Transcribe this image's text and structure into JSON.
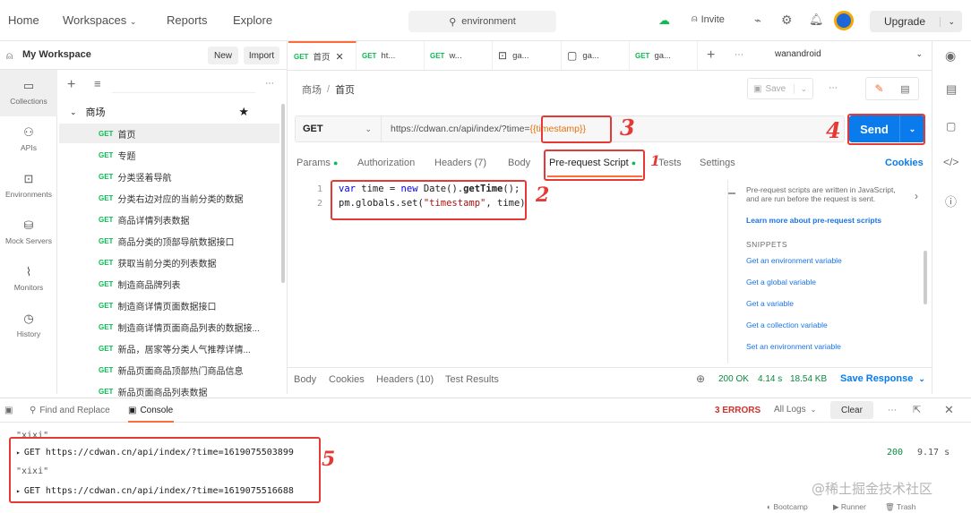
{
  "topbar": {
    "nav": [
      "Home",
      "Workspaces",
      "Reports",
      "Explore"
    ],
    "search_text": "environment",
    "invite": "Invite",
    "upgrade": "Upgrade"
  },
  "sidebar": {
    "workspace": "My Workspace",
    "new_label": "New",
    "import_label": "Import",
    "nav": [
      "Collections",
      "APIs",
      "Environments",
      "Mock Servers",
      "Monitors",
      "History"
    ],
    "collection_name": "商场",
    "method": "GET",
    "requests": [
      "首页",
      "专题",
      "分类竖着导航",
      "分类右边对应的当前分类的数据",
      "商品详情列表数据",
      "商品分类的顶部导航数据接口",
      "获取当前分类的列表数据",
      "制造商品牌列表",
      "制造商详情页面数据接口",
      "制造商详情页面商品列表的数据接...",
      "新品，居家等分类人气推荐详情...",
      "新品页面商品顶部热门商品信息",
      "新品页面商品列表数据"
    ]
  },
  "tabs": [
    {
      "method": "GET",
      "label": "首页"
    },
    {
      "method": "GET",
      "label": "ht..."
    },
    {
      "method": "GET",
      "label": "w..."
    },
    {
      "method": "",
      "label": "ga..."
    },
    {
      "method": "",
      "label": "ga..."
    },
    {
      "method": "GET",
      "label": "ga..."
    }
  ],
  "environment": "wanandroid",
  "breadcrumb": {
    "parent": "商场",
    "sep": "/",
    "current": "首页"
  },
  "save_label": "Save",
  "request": {
    "method": "GET",
    "url_prefix": "https://cdwan.cn/api/index/?time=",
    "url_var": "{{timestamp}}",
    "send": "Send",
    "tabs": [
      "Params",
      "Authorization",
      "Headers (7)",
      "Body",
      "Pre-request Script",
      "Tests",
      "Settings"
    ],
    "cookies": "Cookies"
  },
  "script": {
    "line_numbers": [
      "1",
      "2"
    ],
    "line1": {
      "kw1": "var",
      "mid": " time = ",
      "kw2": "new",
      "rest": " Date().",
      "fn": "getTime",
      "end": "();"
    },
    "line2": {
      "start": "pm.globals.set(",
      "str": "\"timestamp\"",
      "end": ", time)"
    }
  },
  "snippets": {
    "info": "Pre-request scripts are written in JavaScript, and are run before the request is sent.",
    "learn": "Learn more about pre-request scripts",
    "title": "SNIPPETS",
    "items": [
      "Get an environment variable",
      "Get a global variable",
      "Get a variable",
      "Get a collection variable",
      "Set an environment variable"
    ]
  },
  "response": {
    "tabs": [
      "Body",
      "Cookies",
      "Headers (10)",
      "Test Results"
    ],
    "status": "200 OK",
    "time": "4.14 s",
    "size": "18.54 KB",
    "save": "Save Response"
  },
  "console": {
    "find_replace": "Find and Replace",
    "console_tab": "Console",
    "errors": "3 ERRORS",
    "logs_filter": "All Logs",
    "clear": "Clear",
    "rows": [
      {
        "type": "log",
        "text": "\"xixi\""
      },
      {
        "type": "req",
        "text": "GET https://cdwan.cn/api/index/?time=1619075503899",
        "status": "200",
        "time": "9.17 s"
      },
      {
        "type": "log",
        "text": "\"xixi\""
      },
      {
        "type": "req",
        "text": "GET https://cdwan.cn/api/index/?time=1619075516688",
        "status": "",
        "time": ""
      }
    ]
  },
  "statusbar": [
    "Bootcamp",
    "Runner",
    "Trash"
  ],
  "annotations": [
    "1",
    "2",
    "3",
    "4",
    "5"
  ],
  "watermark": "@稀土掘金技术社区",
  "colors": {
    "accent": "#097bed",
    "get": "#0cbb52",
    "annotation": "#e53935",
    "active_tab": "#ff6c37"
  }
}
